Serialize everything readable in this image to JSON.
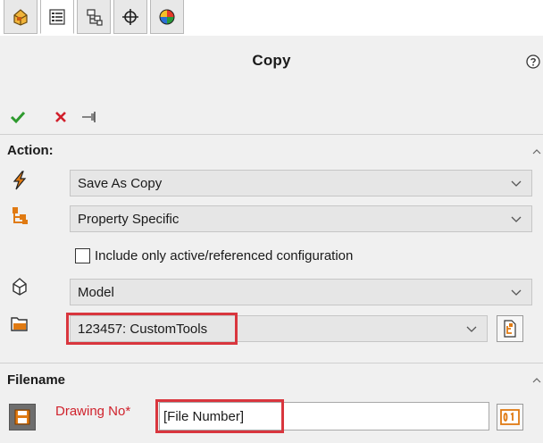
{
  "tabs": [
    {
      "name": "feature-manager",
      "icon": "feature-manager-icon"
    },
    {
      "name": "property-manager",
      "icon": "property-manager-icon",
      "active": true
    },
    {
      "name": "configuration-manager",
      "icon": "configuration-manager-icon"
    },
    {
      "name": "dimxpert-manager",
      "icon": "dimxpert-icon"
    },
    {
      "name": "display-manager",
      "icon": "display-manager-icon"
    }
  ],
  "panel": {
    "title": "Copy",
    "commands": [
      "ok",
      "cancel",
      "pin"
    ]
  },
  "action_section": {
    "heading": "Action:",
    "action_select": "Save As Copy",
    "source_select": "Property Specific",
    "checkbox_label": "Include only active/referenced configuration",
    "checkbox_checked": false,
    "type_select": "Model",
    "destination_select": "123457: CustomTools"
  },
  "filename_section": {
    "heading": "Filename",
    "field_label": "Drawing No*",
    "field_value": "[File Number]"
  },
  "colors": {
    "accent_orange": "#e07a12",
    "highlight_red": "#d9363e",
    "ok_green": "#2e9a2e",
    "cancel_red": "#d11f2b",
    "required_red": "#d0232d"
  }
}
